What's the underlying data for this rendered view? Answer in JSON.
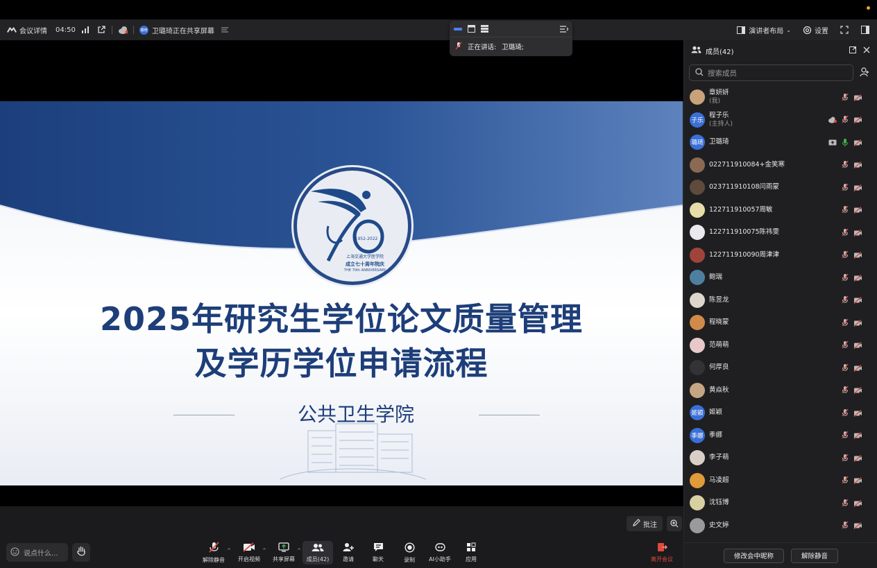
{
  "topbar": {
    "meeting_info": "会议详情",
    "timer": "04:50",
    "sharer_badge": "璐琦",
    "sharing_text": "卫璐琦正在共享屏幕",
    "layout_label": "演讲者布局",
    "settings_label": "设置"
  },
  "speaker_panel": {
    "speaking_label": "正在讲话:",
    "speaker_name": "卫璐琦;"
  },
  "slide": {
    "title_line1": "2025年研究生学位论文质量管理",
    "title_line2": "及学历学位申请流程",
    "subtitle": "公共卫生学院",
    "logo_years": "1952-2022",
    "logo_cn": "成立七十周年院庆",
    "logo_en": "THE 70th ANNIVERSARY",
    "logo_school": "上海交通大学医学院"
  },
  "annotation": {
    "label": "批注"
  },
  "bottombar": {
    "say_placeholder": "说点什么...",
    "controls": [
      {
        "key": "unmute",
        "label": "解除静音"
      },
      {
        "key": "video",
        "label": "开启视频"
      },
      {
        "key": "share",
        "label": "共享屏幕"
      },
      {
        "key": "members",
        "label": "成员(42)"
      },
      {
        "key": "invite",
        "label": "邀请"
      },
      {
        "key": "chat",
        "label": "聊天"
      },
      {
        "key": "record",
        "label": "录制"
      },
      {
        "key": "ai",
        "label": "AI小助手"
      },
      {
        "key": "apps",
        "label": "应用"
      }
    ],
    "leave_label": "离开会议"
  },
  "sidebar": {
    "title": "成员(42)",
    "search_placeholder": "搜索成员",
    "members": [
      {
        "name": "章妍妍",
        "role": "(我)",
        "avatar_text": "",
        "avatar_color": "#c9a27a"
      },
      {
        "name": "程子乐",
        "role": "(主持人)",
        "avatar_text": "子乐",
        "avatar_color": "#3a6fd6"
      },
      {
        "name": "卫璐琦",
        "role": "",
        "avatar_text": "璐琦",
        "avatar_color": "#3a6fd6"
      },
      {
        "name": "022711910084+金笑寒",
        "role": "",
        "avatar_text": "",
        "avatar_color": "#8a6a52"
      },
      {
        "name": "023711910108闫雨蒙",
        "role": "",
        "avatar_text": "",
        "avatar_color": "#5e4b3c"
      },
      {
        "name": "122711910057周敏",
        "role": "",
        "avatar_text": "",
        "avatar_color": "#e8dca8"
      },
      {
        "name": "122711910075陈祎雯",
        "role": "",
        "avatar_text": "",
        "avatar_color": "#e9e9ee"
      },
      {
        "name": "122711910090周津津",
        "role": "",
        "avatar_text": "",
        "avatar_color": "#a0443a"
      },
      {
        "name": "鲍瑞",
        "role": "",
        "avatar_text": "",
        "avatar_color": "#4f7fa0"
      },
      {
        "name": "陈昱龙",
        "role": "",
        "avatar_text": "",
        "avatar_color": "#dcd6cc"
      },
      {
        "name": "程晓蒙",
        "role": "",
        "avatar_text": "",
        "avatar_color": "#d08a4a"
      },
      {
        "name": "范萌萌",
        "role": "",
        "avatar_text": "",
        "avatar_color": "#e8c8c8"
      },
      {
        "name": "何厚良",
        "role": "",
        "avatar_text": "",
        "avatar_color": "#333336"
      },
      {
        "name": "黄焱秋",
        "role": "",
        "avatar_text": "",
        "avatar_color": "#c6a583"
      },
      {
        "name": "姬颖",
        "role": "",
        "avatar_text": "姬颖",
        "avatar_color": "#3a6fd6"
      },
      {
        "name": "季娜",
        "role": "",
        "avatar_text": "季娜",
        "avatar_color": "#3a6fd6"
      },
      {
        "name": "李子萌",
        "role": "",
        "avatar_text": "",
        "avatar_color": "#d9cfc6"
      },
      {
        "name": "马凌超",
        "role": "",
        "avatar_text": "",
        "avatar_color": "#e09a3a"
      },
      {
        "name": "沈钰博",
        "role": "",
        "avatar_text": "",
        "avatar_color": "#d8d0a0"
      },
      {
        "name": "史文婷",
        "role": "",
        "avatar_text": "",
        "avatar_color": "#9a9a9a"
      }
    ],
    "rename_button": "修改会中昵称",
    "unmute_all_button": "解除静音"
  },
  "colors": {
    "accent": "#3a6fd6",
    "slide_blue": "#1d3e79",
    "muted_red": "#e0493c",
    "mic_green": "#3bb44a"
  }
}
